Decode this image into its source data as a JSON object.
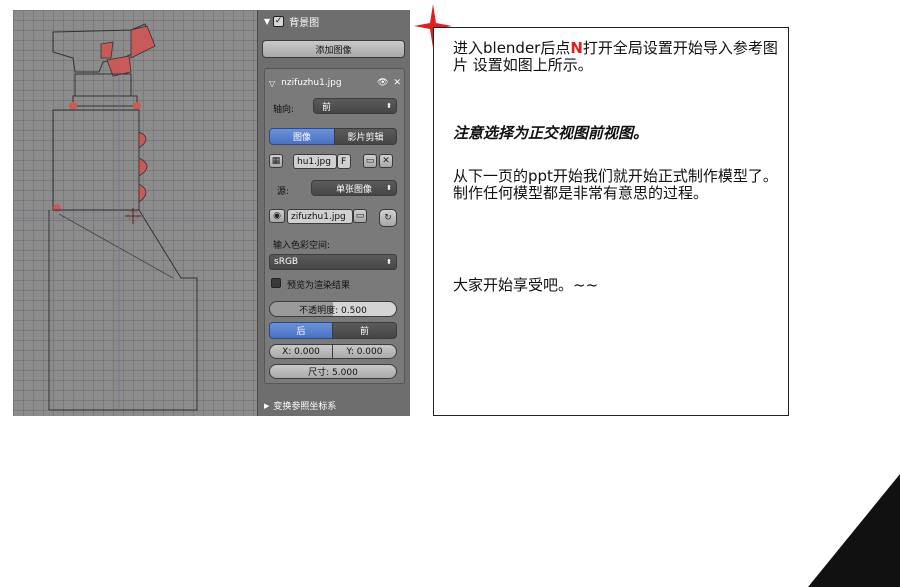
{
  "panel": {
    "header_title": "背景图",
    "add_image_button": "添加图像",
    "image_item_name": "nzifuzhu1.jpg",
    "axis_label": "轴向:",
    "axis_value": "前",
    "tab_image": "图像",
    "tab_movie": "影片剪辑",
    "file_name": "hu1.jpg",
    "file_flag": "F",
    "source_label": "源:",
    "source_value": "单张图像",
    "image_file": "zifuzhu1.jpg",
    "colorspace_label": "输入色彩空间:",
    "colorspace_value": "sRGB",
    "preview_label": "预览为渲染结果",
    "opacity_label": "不透明度: 0.500",
    "back_button": "后",
    "front_button": "前",
    "x_field": "X: 0.000",
    "y_field": "Y: 0.000",
    "size_field": "尺寸: 5.000",
    "transform_header": "变换参照坐标系"
  },
  "textbox": {
    "line1_prefix": "进入blender后点",
    "line1_key": "N",
    "line1_suffix": "打开全局设置开始导入参考图片 设置如图上所示。",
    "note": "注意选择为正交视图前视图。",
    "para2": "从下一页的ppt开始我们就开始正式制作模型了。 制作任何模型都是非常有意思的过程。",
    "para3": "大家开始享受吧。~~"
  },
  "colors": {
    "accent_red": "#e02020",
    "blender_blue": "#4a72c4"
  },
  "icons": {
    "star": "four-point-star-icon",
    "corner": "black-triangle-corner"
  }
}
